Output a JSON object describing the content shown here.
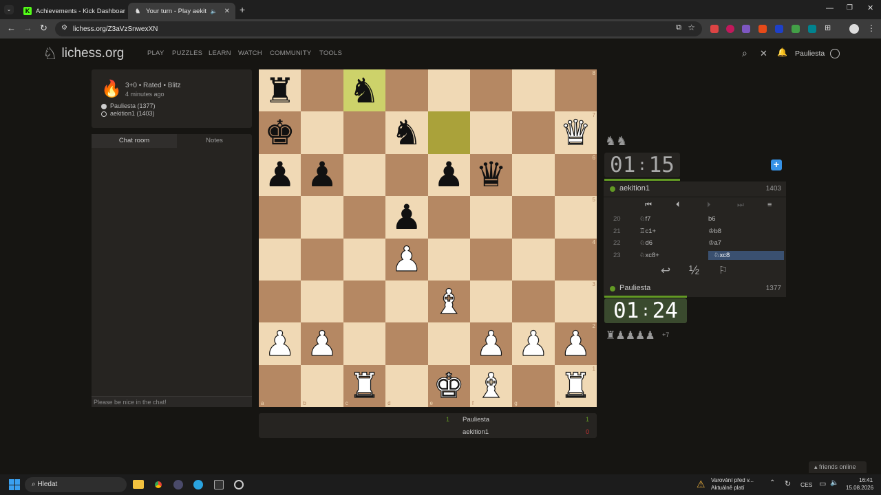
{
  "browser": {
    "tabs": [
      {
        "title": "Achievements - Kick Dashboard",
        "icon": "kick-icon"
      },
      {
        "title": "Your turn - Play aekition1 -",
        "icon": "lichess-icon"
      }
    ],
    "url": "lichess.org/Z3aVzSnwexXN"
  },
  "nav": {
    "logo": "lichess.org",
    "links": [
      "PLAY",
      "PUZZLES",
      "LEARN",
      "WATCH",
      "COMMUNITY",
      "TOOLS"
    ],
    "username": "Pauliesta"
  },
  "game_info": {
    "type": "3+0 • Rated • Blitz",
    "time_ago": "4 minutes ago",
    "white": "Pauliesta (1377)",
    "black": "aekition1 (1403)"
  },
  "chat": {
    "tabs": [
      "Chat room",
      "Notes"
    ],
    "placeholder": "Please be nice in the chat!"
  },
  "board": {
    "rows": [
      [
        "bR",
        "",
        "bN",
        "",
        "",
        "",
        "",
        ""
      ],
      [
        "bK",
        "",
        "",
        "bN",
        "",
        "",
        "",
        "wQ"
      ],
      [
        "bP",
        "bP",
        "",
        "",
        "bP",
        "bQ",
        "",
        ""
      ],
      [
        "",
        "",
        "",
        "bP",
        "",
        "",
        "",
        ""
      ],
      [
        "",
        "",
        "",
        "wP",
        "",
        "",
        "",
        ""
      ],
      [
        "",
        "",
        "",
        "",
        "wB",
        "",
        "",
        ""
      ],
      [
        "wP",
        "wP",
        "",
        "",
        "",
        "wP",
        "wP",
        "wP"
      ],
      [
        "",
        "",
        "wR",
        "",
        "wK",
        "wB",
        "",
        "wR"
      ]
    ],
    "highlights": [
      "c8",
      "e7"
    ],
    "files": [
      "a",
      "b",
      "c",
      "d",
      "e",
      "f",
      "g",
      "h"
    ],
    "ranks": [
      "8",
      "7",
      "6",
      "5",
      "4",
      "3",
      "2",
      "1"
    ]
  },
  "opponent": {
    "clock": [
      "01",
      "15"
    ],
    "name": "aekition1",
    "rating": "1403"
  },
  "player": {
    "clock": [
      "01",
      "24"
    ],
    "name": "Pauliesta",
    "rating": "1377",
    "material": "+7"
  },
  "moves": [
    {
      "num": "20",
      "white": "♘f7",
      "black": "b6"
    },
    {
      "num": "21",
      "white": "♖c1+",
      "black": "♔b8"
    },
    {
      "num": "22",
      "white": "♘d6",
      "black": "♔a7"
    },
    {
      "num": "23",
      "white": "♘xc8+",
      "black": "♘xc8"
    }
  ],
  "draw_label": "½",
  "crosstable": {
    "rows": [
      {
        "name": "Pauliesta",
        "left": "1",
        "score": "1"
      },
      {
        "name": "aekition1",
        "score": "0"
      }
    ]
  },
  "friends": "friends online",
  "taskbar": {
    "search": "Hledat",
    "notice_line1": "Varování před v...",
    "notice_line2": "Aktuálně platí",
    "lang": "CES",
    "time": "16:41",
    "date": "15.08.2026"
  }
}
